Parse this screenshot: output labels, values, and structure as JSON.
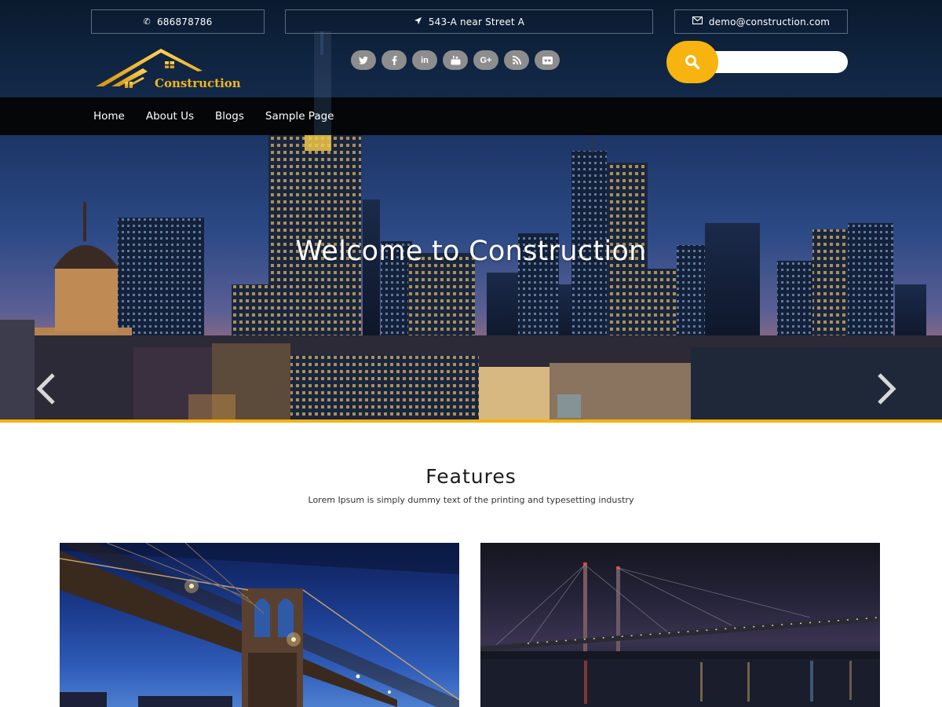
{
  "topbar": {
    "phone": "686878786",
    "address": "543-A near Street A",
    "email": "demo@construction.com",
    "phone_icon": "phone-icon",
    "address_icon": "location-arrow-icon",
    "email_icon": "envelope-icon"
  },
  "logo": {
    "text": "Construction"
  },
  "social": {
    "items": [
      {
        "name": "twitter-icon",
        "glyph": "t"
      },
      {
        "name": "facebook-icon",
        "glyph": "f"
      },
      {
        "name": "linkedin-icon",
        "glyph": "in"
      },
      {
        "name": "youtube-icon",
        "glyph": "▶"
      },
      {
        "name": "google-plus-icon",
        "glyph": "G+"
      },
      {
        "name": "rss-icon",
        "glyph": "◉"
      },
      {
        "name": "flickr-icon",
        "glyph": "●●"
      }
    ]
  },
  "search": {
    "placeholder": "",
    "icon": "search-icon"
  },
  "nav": {
    "items": [
      {
        "label": "Home"
      },
      {
        "label": "About Us"
      },
      {
        "label": "Blogs"
      },
      {
        "label": "Sample Page"
      }
    ]
  },
  "hero": {
    "title": "Welcome to Construction",
    "prev_icon": "chevron-left-icon",
    "next_icon": "chevron-right-icon"
  },
  "features": {
    "title": "Features",
    "subtitle": "Lorem Ipsum is simply dummy text of the printing and typesetting industry"
  },
  "colors": {
    "accent": "#f5b20f",
    "header_bg": "#0f2440",
    "nav_bg": "#050607",
    "social_bg": "#8d8d8d"
  }
}
